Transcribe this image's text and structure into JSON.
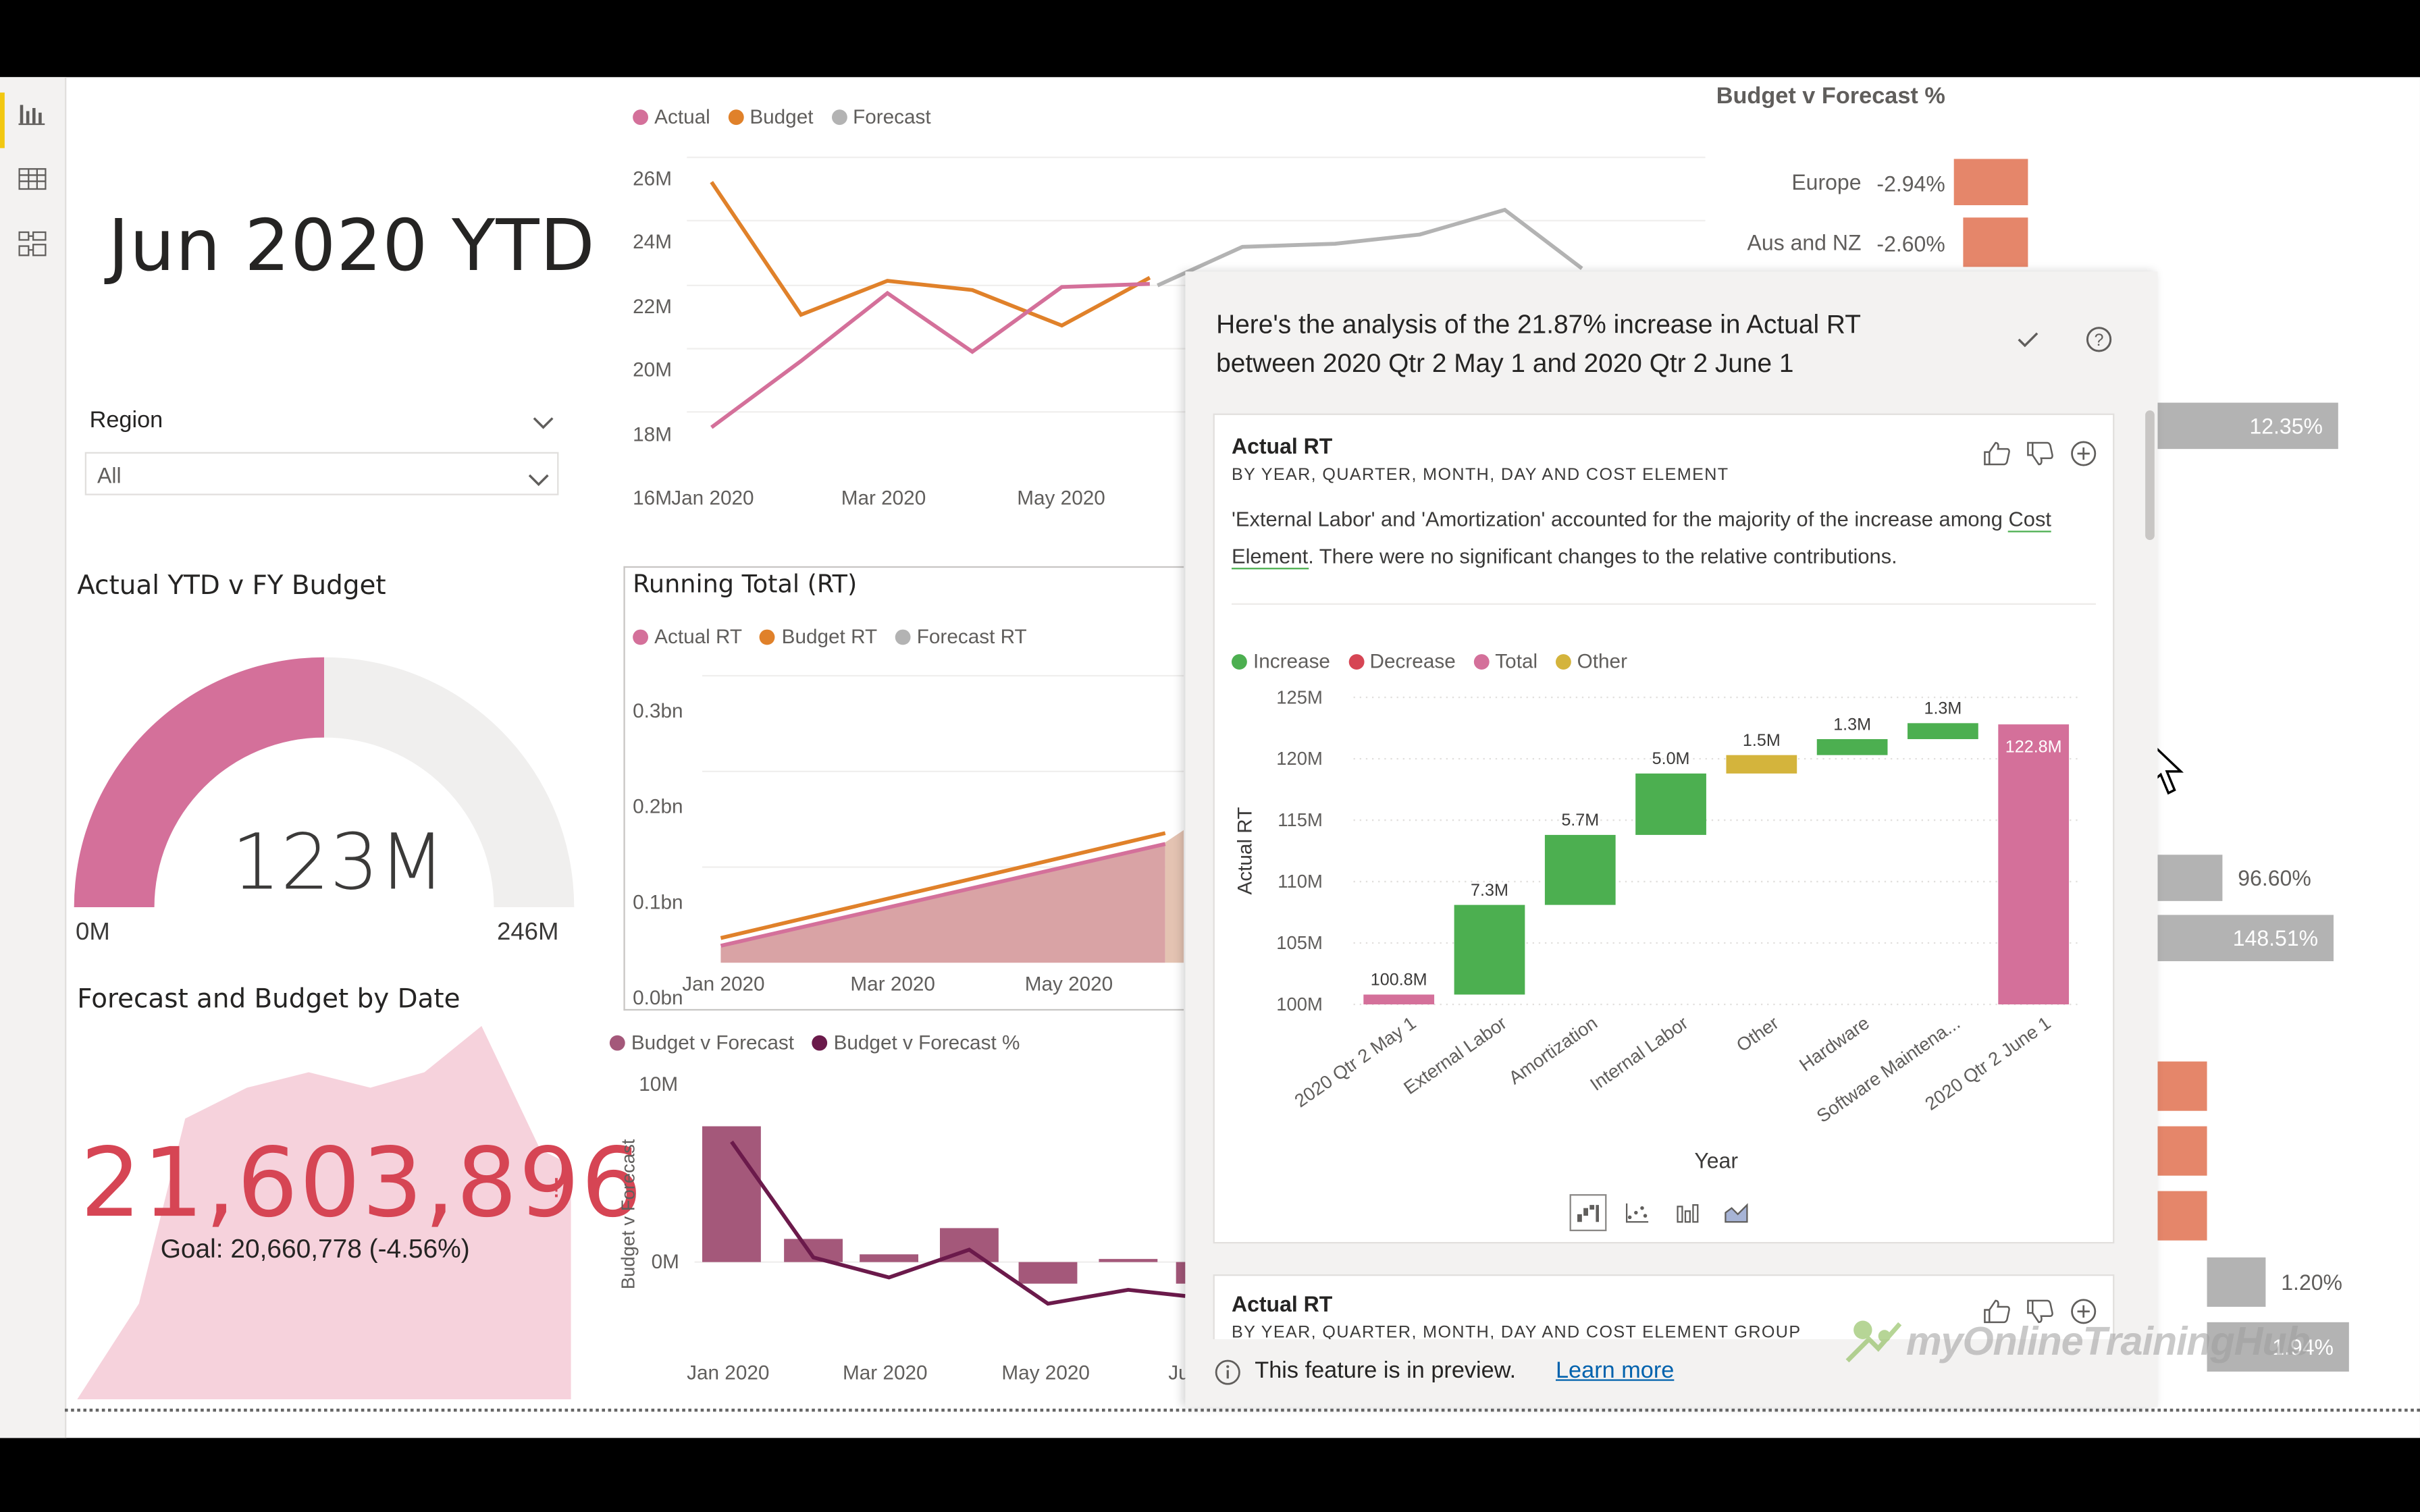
{
  "page": {
    "title": "Jun 2020 YTD"
  },
  "slicer": {
    "label": "Region",
    "value": "All"
  },
  "gauge": {
    "title": "Actual YTD v FY Budget",
    "value_label": "123M",
    "min_label": "0M",
    "max_label": "246M",
    "value": 123,
    "max": 246,
    "fill_color": "#d4709a",
    "track_color": "#f0efee"
  },
  "kpi": {
    "title": "Forecast and Budget by Date",
    "value": "21,603,896",
    "marker": "!",
    "goal": "Goal: 20,660,778 (-4.56%)",
    "value_color": "#d64554"
  },
  "line_chart_top": {
    "legend": [
      {
        "name": "Actual",
        "color": "#d4709a"
      },
      {
        "name": "Budget",
        "color": "#e0812a"
      },
      {
        "name": "Forecast",
        "color": "#b3b3b3"
      }
    ],
    "y_ticks": [
      "26M",
      "24M",
      "22M",
      "20M",
      "18M",
      "16M"
    ],
    "x_ticks": [
      "Jan 2020",
      "Mar 2020",
      "May 2020"
    ]
  },
  "running_total": {
    "title": "Running Total (RT)",
    "legend": [
      {
        "name": "Actual RT",
        "color": "#d4709a"
      },
      {
        "name": "Budget RT",
        "color": "#e0812a"
      },
      {
        "name": "Forecast RT",
        "color": "#b3b3b3"
      }
    ],
    "y_ticks": [
      "0.3bn",
      "0.2bn",
      "0.1bn",
      "0.0bn"
    ],
    "x_ticks": [
      "Jan 2020",
      "Mar 2020",
      "May 2020"
    ]
  },
  "bvf_chart": {
    "legend": [
      {
        "name": "Budget v Forecast",
        "color": "#a4587a"
      },
      {
        "name": "Budget v Forecast %",
        "color": "#6b1a4b"
      }
    ],
    "y_label": "Budget v Forecast",
    "y_ticks": [
      "10M",
      "0M"
    ],
    "x_ticks": [
      "Jan 2020",
      "Mar 2020",
      "May 2020",
      "Ju"
    ]
  },
  "budget_pct": {
    "title": "Budget v Forecast %",
    "rows": [
      {
        "label": "Europe",
        "value": "-2.94%"
      },
      {
        "label": "Aus and NZ",
        "value": "-2.60%"
      }
    ],
    "side_values": [
      "12.35%",
      "96.60%",
      "148.51%",
      "1.20%",
      "1.94%"
    ]
  },
  "analysis_panel": {
    "headline_1": "Here's the analysis of the 21.87% increase in Actual RT",
    "headline_2": "between 2020 Qtr 2 May 1 and 2020 Qtr 2 June 1",
    "card1": {
      "title": "Actual RT",
      "subtitle": "BY YEAR, QUARTER, MONTH, DAY AND COST ELEMENT",
      "desc_1": "'External Labor' and 'Amortization' accounted for the majority of the increase among",
      "desc_link": "Cost Element",
      "desc_2": ". There were no significant changes to the relative contributions."
    },
    "card2": {
      "title": "Actual RT",
      "subtitle": "BY YEAR, QUARTER, MONTH, DAY AND COST ELEMENT GROUP"
    },
    "footer_text": "This feature is in preview.",
    "footer_link": "Learn more"
  },
  "chart_data": {
    "type": "bar",
    "subtype": "waterfall",
    "legend": [
      {
        "name": "Increase",
        "color": "#4caf50"
      },
      {
        "name": "Decrease",
        "color": "#d64554"
      },
      {
        "name": "Total",
        "color": "#d4709a"
      },
      {
        "name": "Other",
        "color": "#d4b43c"
      }
    ],
    "categories": [
      "2020 Qtr 2 May 1",
      "External Labor",
      "Amortization",
      "Internal Labor",
      "Other",
      "Hardware",
      "Software Maintena...",
      "2020 Qtr 2 June 1"
    ],
    "values": [
      100.8,
      7.3,
      5.7,
      5.0,
      1.5,
      1.3,
      1.3,
      122.8
    ],
    "kinds": [
      "total",
      "increase",
      "increase",
      "increase",
      "other",
      "increase",
      "increase",
      "total"
    ],
    "data_labels": [
      "100.8M",
      "7.3M",
      "5.7M",
      "5.0M",
      "1.5M",
      "1.3M",
      "1.3M",
      "122.8M"
    ],
    "y_ticks": [
      "125M",
      "120M",
      "115M",
      "110M",
      "105M",
      "100M"
    ],
    "ylim": [
      100,
      125
    ],
    "xlabel": "Year",
    "ylabel": "Actual RT",
    "grid": true,
    "legend_position": "top-left"
  },
  "watermark": "myOnlineTrainingHub"
}
